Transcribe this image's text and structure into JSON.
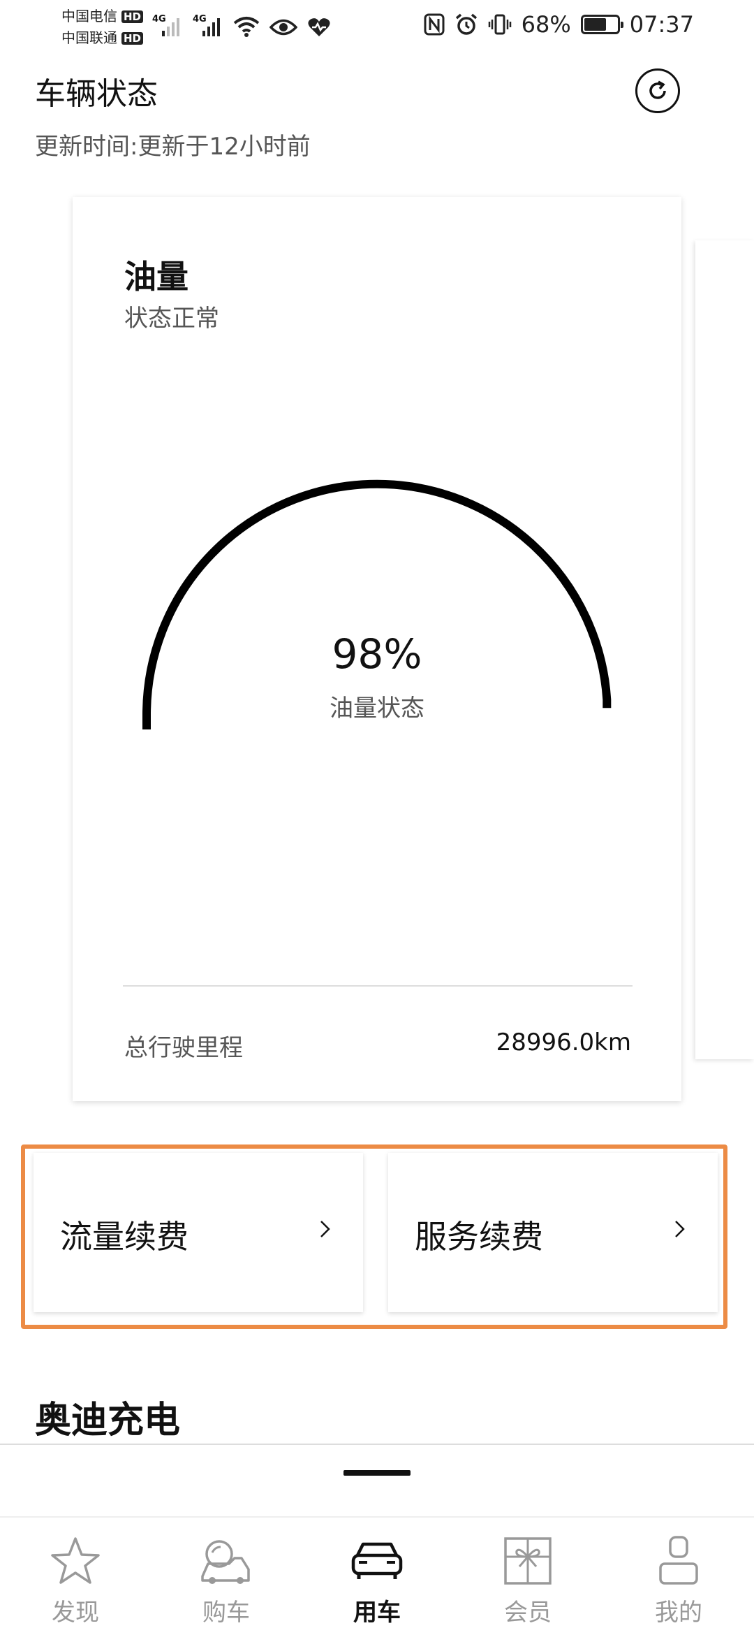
{
  "status_bar": {
    "carrier1": "中国电信",
    "carrier2": "中国联通",
    "hd_badge": "HD",
    "network_type": "4G",
    "battery_percent": "68%",
    "battery_fraction": 0.68,
    "time": "07:37"
  },
  "header": {
    "title": "车辆状态",
    "update_label": "更新时间:",
    "update_value": "更新于12小时前"
  },
  "fuel_card": {
    "title": "油量",
    "status": "状态正常",
    "gauge_value": "98%",
    "gauge_fraction": 0.98,
    "gauge_label": "油量状态",
    "mileage_label": "总行驶里程",
    "mileage_value": "28996.0km"
  },
  "renewals": {
    "data_renewal": "流量续费",
    "service_renewal": "服务续费"
  },
  "charging_section": {
    "title": "奥迪充电"
  },
  "tabbar": {
    "tabs": [
      {
        "label": "发现",
        "icon": "star-icon"
      },
      {
        "label": "购车",
        "icon": "car-search-icon"
      },
      {
        "label": "用车",
        "icon": "car-icon",
        "active": true
      },
      {
        "label": "会员",
        "icon": "gift-icon"
      },
      {
        "label": "我的",
        "icon": "person-icon"
      }
    ]
  },
  "colors": {
    "highlight": "#ec8b45",
    "text_primary": "#111111",
    "text_secondary": "#555555",
    "tab_inactive": "#999999"
  }
}
